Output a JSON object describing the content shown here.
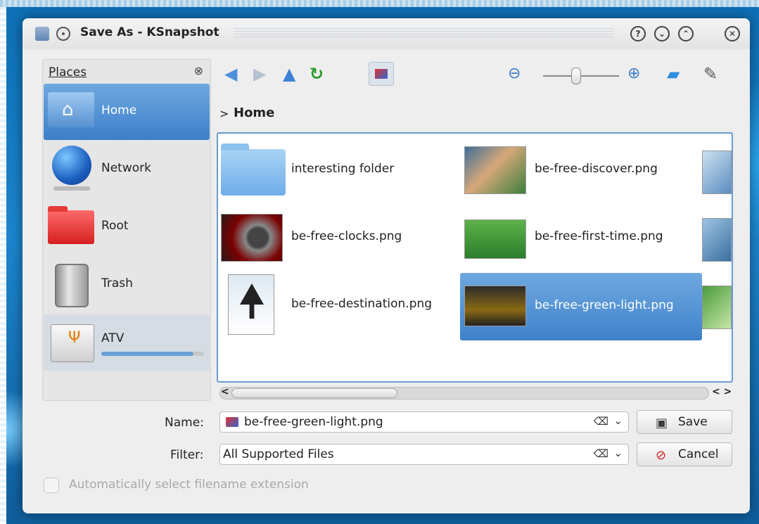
{
  "window": {
    "title": "Save As - KSnapshot",
    "buttons": {
      "help": "?",
      "minimize": "⌄",
      "maximize": "⌃",
      "close": "✕"
    }
  },
  "places": {
    "header": "Places",
    "items": [
      {
        "label": "Home",
        "icon": "home-icon",
        "selected": true
      },
      {
        "label": "Network",
        "icon": "network-icon"
      },
      {
        "label": "Root",
        "icon": "folder-red-icon"
      },
      {
        "label": "Trash",
        "icon": "trash-icon"
      },
      {
        "label": "ATV",
        "icon": "usb-drive-icon",
        "usage_fraction": 0.9
      }
    ]
  },
  "toolbar": {
    "back": "back-arrow-icon",
    "forward": "forward-arrow-icon",
    "up": "up-arrow-icon",
    "reload": "reload-icon",
    "preview": "preview-icon",
    "zoom_out": "zoom-out-icon",
    "zoom_in": "zoom-in-icon",
    "new_folder": "new-folder-icon",
    "options": "options-icon"
  },
  "breadcrumb": {
    "separator": ">",
    "current": "Home"
  },
  "files": [
    {
      "name": "interesting folder",
      "type": "folder"
    },
    {
      "name": "be-free-discover.png",
      "type": "image"
    },
    {
      "name": "be-free-clocks.png",
      "type": "image"
    },
    {
      "name": "be-free-first-time.png",
      "type": "image"
    },
    {
      "name": "be-free-destination.png",
      "type": "image"
    },
    {
      "name": "be-free-green-light.png",
      "type": "image",
      "selected": true
    }
  ],
  "scroll": {
    "left": "<",
    "right": "< >"
  },
  "form": {
    "name_label": "Name:",
    "name_value": "be-free-green-light.png",
    "filter_label": "Filter:",
    "filter_value": "All Supported Files",
    "clear_icon": "⌫",
    "dropdown_icon": "⌄",
    "save_button": "Save",
    "cancel_button": "Cancel",
    "auto_extension_label": "Automatically select filename extension",
    "auto_extension_checked": false
  },
  "colors": {
    "selection": "#3f82cb",
    "accent": "#6a9bd0",
    "desktop": "#1c86cf"
  }
}
